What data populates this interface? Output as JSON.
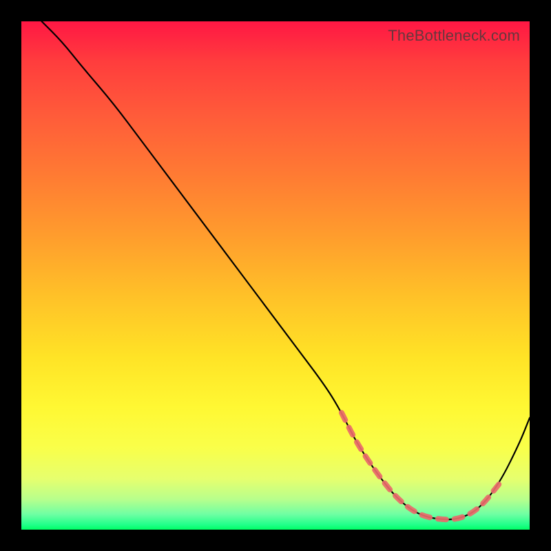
{
  "watermark": "TheBottleneck.com",
  "chart_data": {
    "type": "line",
    "title": "",
    "xlabel": "",
    "ylabel": "",
    "xlim": [
      0,
      100
    ],
    "ylim": [
      0,
      100
    ],
    "series": [
      {
        "name": "curve",
        "x": [
          4,
          8,
          12,
          18,
          24,
          30,
          36,
          42,
          48,
          54,
          60,
          63,
          66,
          70,
          74,
          78,
          82,
          86,
          90,
          94,
          98,
          100
        ],
        "y": [
          100,
          96,
          91,
          84,
          76,
          68,
          60,
          52,
          44,
          36,
          28,
          23,
          17,
          11,
          6,
          3,
          2,
          2,
          4,
          9,
          17,
          22
        ]
      }
    ],
    "optimal_band": {
      "x_start": 63,
      "x_end": 94
    },
    "background": "red-yellow-green vertical gradient"
  }
}
